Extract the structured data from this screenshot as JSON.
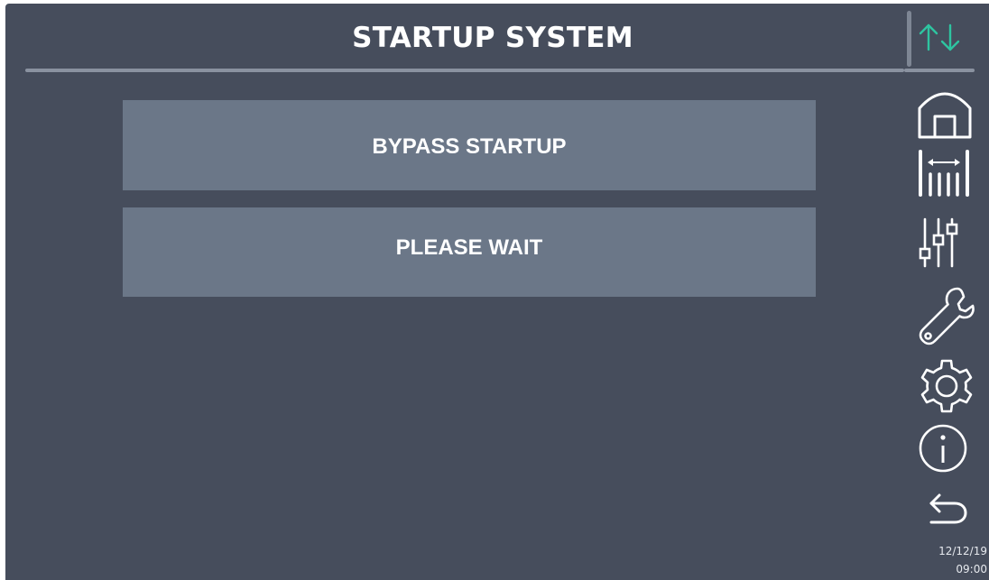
{
  "header": {
    "title": "STARTUP SYSTEM",
    "comm_status_icon": "arrows-up-down-icon"
  },
  "main": {
    "buttons": [
      {
        "label": "BYPASS STARTUP"
      },
      {
        "label": "PLEASE WAIT"
      }
    ]
  },
  "sidebar": {
    "items": [
      {
        "icon": "home-icon"
      },
      {
        "icon": "measurements-icon"
      },
      {
        "icon": "sliders-icon"
      },
      {
        "icon": "wrench-icon"
      },
      {
        "icon": "gear-icon"
      },
      {
        "icon": "info-icon"
      },
      {
        "icon": "back-arrow-icon"
      }
    ]
  },
  "status": {
    "date": "12/12/19",
    "time": "09:00"
  },
  "colors": {
    "background": "#464d5c",
    "button": "#6b7788",
    "accent": "#2ec4a0",
    "text": "#ffffff"
  }
}
